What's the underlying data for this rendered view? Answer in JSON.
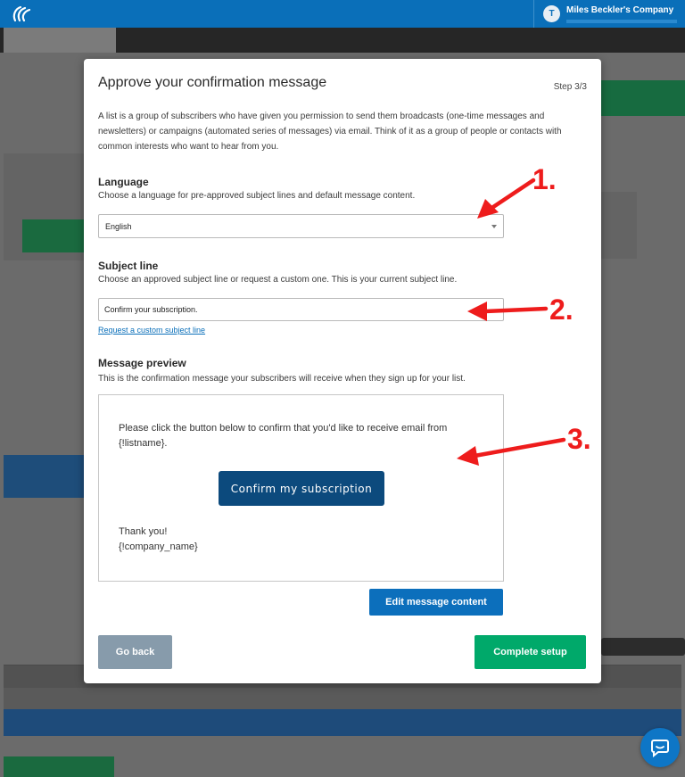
{
  "topbar": {
    "account_initial": "T",
    "account_name": "Miles Beckler's Company",
    "brand_color": "#0a6fb9"
  },
  "chat": {
    "icon": "chat-bubble-icon"
  },
  "modal": {
    "title": "Approve your confirmation message",
    "step": "Step 3/3",
    "intro": "A list is a group of subscribers who have given you permission to send them broadcasts (one-time messages and newsletters) or campaigns (automated series of messages) via email. Think of it as a group of people or contacts with common interests who want to hear from you.",
    "language": {
      "label": "Language",
      "description": "Choose a language for pre-approved subject lines and default message content.",
      "selected": "English"
    },
    "subject": {
      "label": "Subject line",
      "description": "Choose an approved subject line or request a custom one. This is your current subject line.",
      "value": "Confirm your subscription.",
      "request_link": "Request a custom subject line"
    },
    "preview": {
      "label": "Message preview",
      "description": "This is the confirmation message your subscribers will receive when they sign up for your list.",
      "body": "Please click the button below to confirm that you'd like to receive email from {!listname}.",
      "button": "Confirm my subscription",
      "thanks": "Thank you!",
      "company": "{!company_name}"
    },
    "edit_button": "Edit message content",
    "back_button": "Go back",
    "complete_button": "Complete setup"
  },
  "annotations": {
    "labels": [
      "1.",
      "2.",
      "3."
    ],
    "color": "#ee1c1c"
  },
  "colors": {
    "primary_blue": "#0c6fbc",
    "dark_blue": "#0c4a7d",
    "green": "#00a96a",
    "grey_button": "#879bab"
  }
}
